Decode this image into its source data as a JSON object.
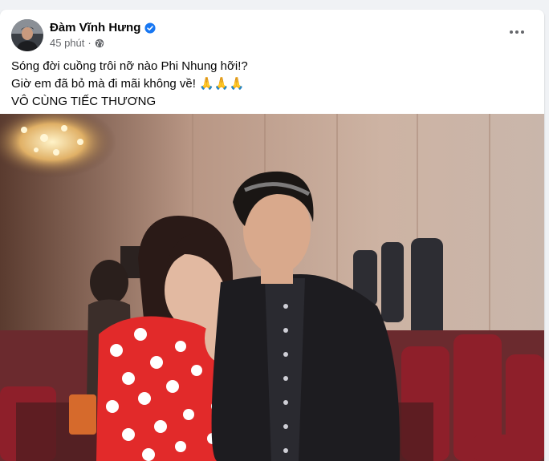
{
  "post": {
    "author": "Đàm Vĩnh Hưng",
    "time": "45 phút",
    "separator": "·",
    "text_lines": [
      "Sóng đời cuồng trôi nỡ nào Phi Nhung hỡi!?",
      "Giờ em đã bỏ mà đi mãi không về! 🙏🙏🙏",
      "VÔ CÙNG TIẾC THƯƠNG"
    ]
  },
  "icons": {
    "verified": "verified-badge-icon",
    "audience": "globe-icon",
    "more": "more-options-icon"
  },
  "colors": {
    "accent": "#1877f2",
    "secondary_text": "#65676b",
    "primary_text": "#050505"
  }
}
